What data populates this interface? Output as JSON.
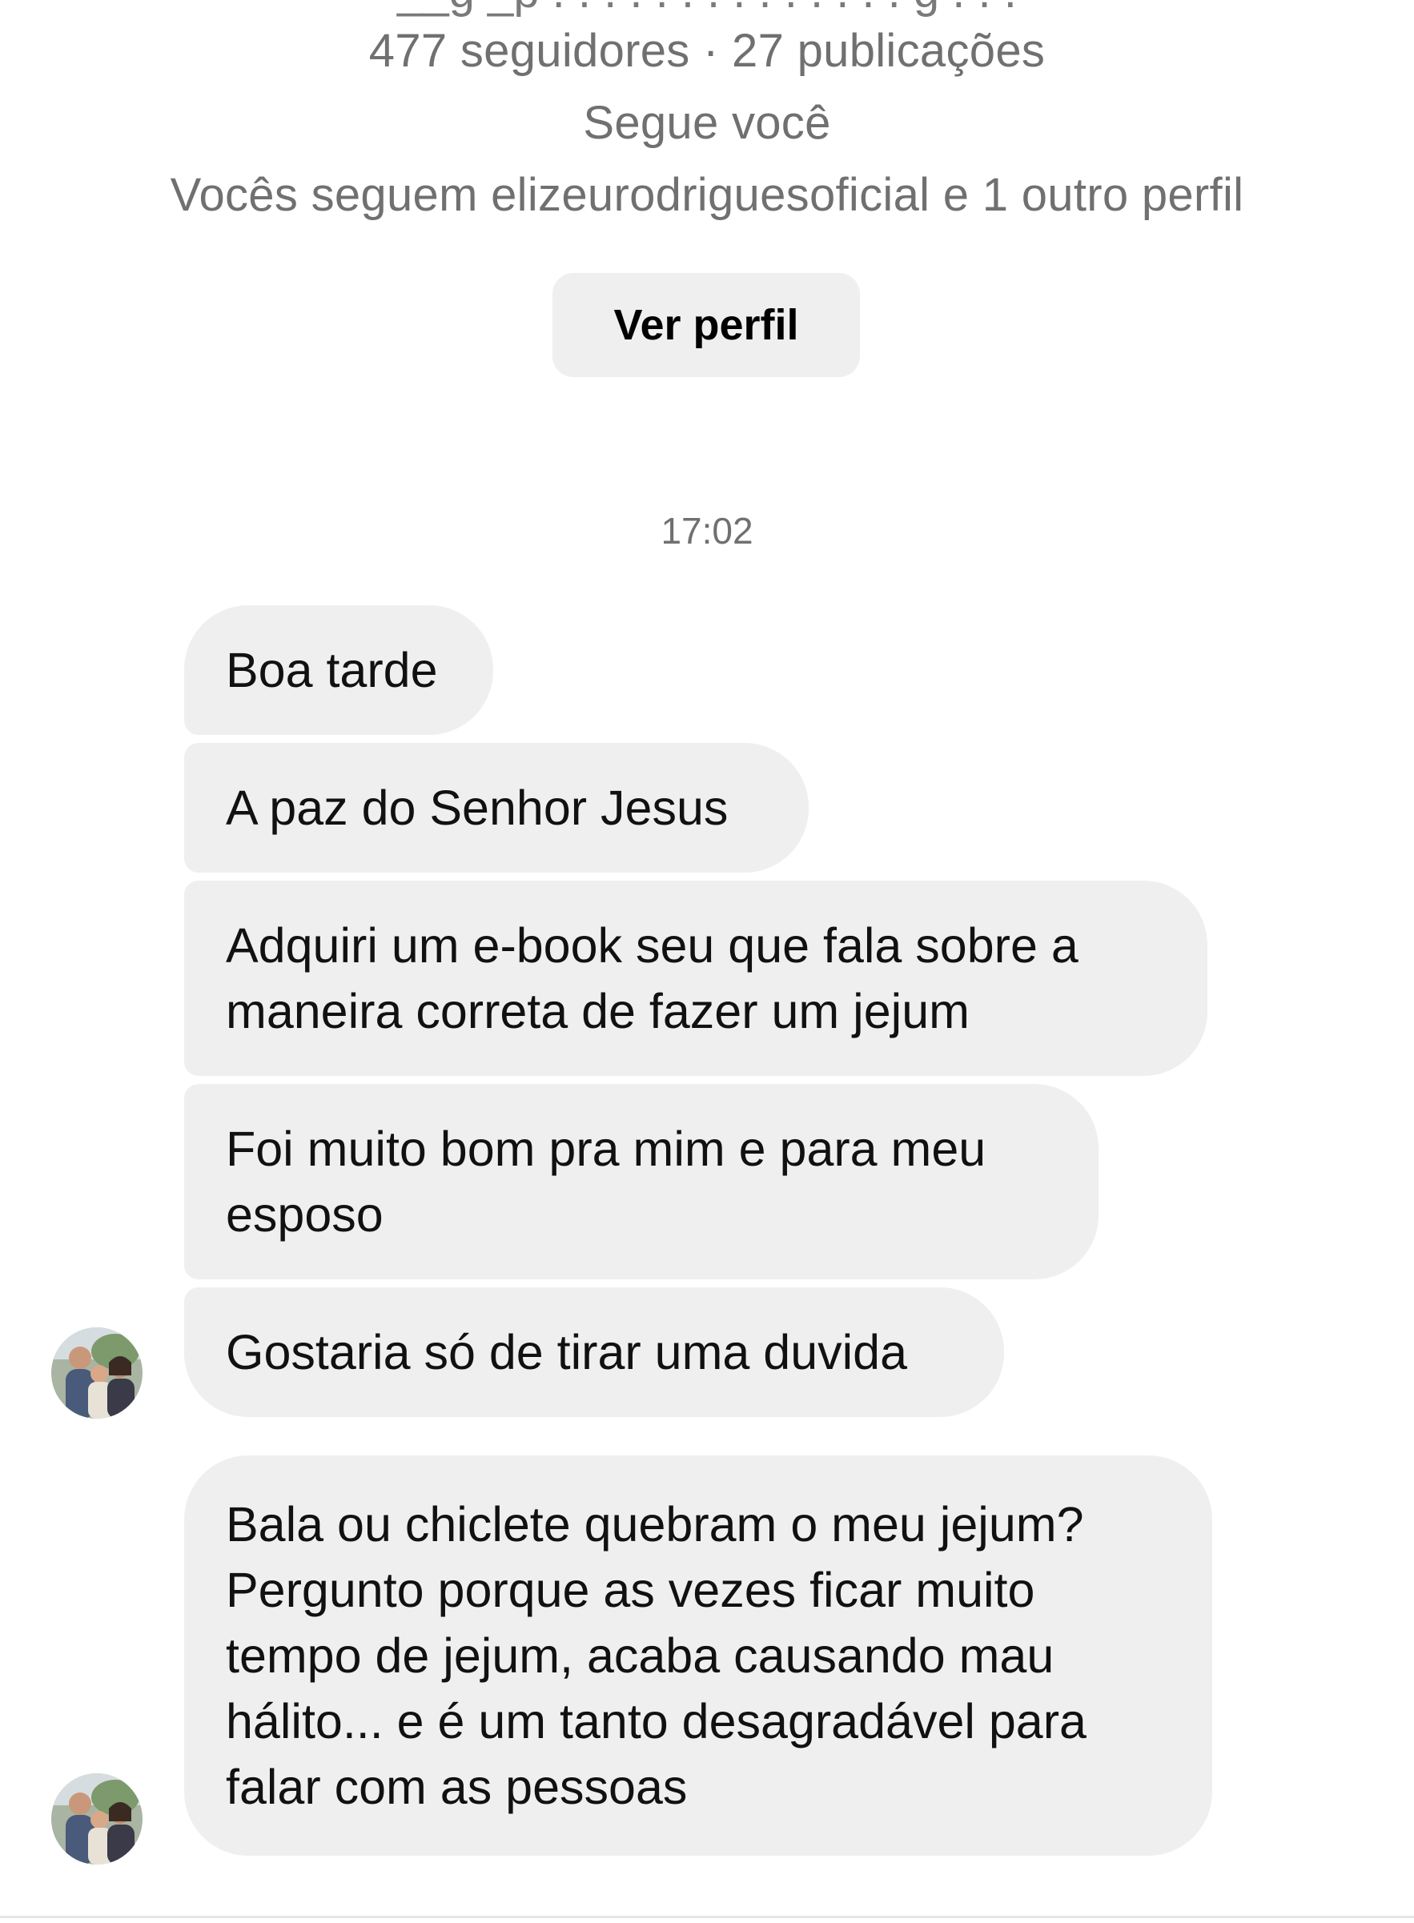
{
  "profile": {
    "username_partial": "__g _p . . . . . . . . . . . . . . g . . .",
    "stats": "477 seguidores · 27 publicações",
    "follow_status": "Segue você",
    "mutual": "Vocês seguem elizeurodriguesoficial e 1 outro perfil",
    "view_profile_label": "Ver perfil"
  },
  "chat": {
    "timestamp": "17:02",
    "messages": [
      {
        "text": "Boa tarde"
      },
      {
        "text": "A paz do Senhor Jesus"
      },
      {
        "lines": [
          "Adquiri um e-book seu que fala sobre a",
          "maneira correta de fazer um jejum"
        ]
      },
      {
        "lines": [
          "Foi muito bom pra mim e para meu",
          "esposo"
        ]
      },
      {
        "text": "Gostaria só de tirar uma duvida"
      },
      {
        "lines": [
          "Bala ou chiclete quebram o meu jejum?",
          "Pergunto porque as vezes ficar muito",
          "tempo de jejum, acaba causando mau",
          "hálito... e é um tanto desagradável para",
          "falar com as pessoas"
        ]
      }
    ]
  },
  "colors": {
    "bubble": "#efefef",
    "secondary_text": "#707070"
  }
}
